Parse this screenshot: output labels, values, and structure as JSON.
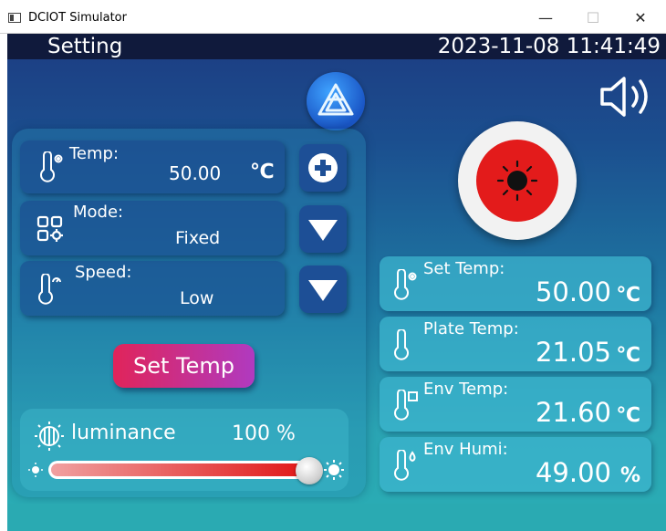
{
  "window": {
    "title": "DCIOT Simulator",
    "minimize": "—",
    "maximize": "☐",
    "close": "✕"
  },
  "header": {
    "page_title": "Setting",
    "datetime": "2023-11-08 11:41:49"
  },
  "settings": {
    "temp": {
      "label": "Temp:",
      "value": "50.00",
      "unit": "℃",
      "icon": "thermometer-gear-icon",
      "button_icon": "plus-icon"
    },
    "mode": {
      "label": "Mode:",
      "value": "Fixed",
      "icon": "mode-grid-icon",
      "button_icon": "dropdown-triangle-icon"
    },
    "speed": {
      "label": "Speed:",
      "value": "Low",
      "icon": "thermometer-gauge-icon",
      "button_icon": "dropdown-triangle-icon"
    }
  },
  "set_temp_button": "Set Temp",
  "luminance": {
    "label": "luminance",
    "value": "100 %",
    "level_fraction": 1.0
  },
  "readings": [
    {
      "label": "Set Temp:",
      "value": "50.00",
      "unit": "℃",
      "icon": "thermometer-gear-icon"
    },
    {
      "label": "Plate Temp:",
      "value": "21.05",
      "unit": "℃",
      "icon": "thermometer-icon"
    },
    {
      "label": "Env Temp:",
      "value": "21.60",
      "unit": "℃",
      "icon": "thermometer-box-icon"
    },
    {
      "label": "Env Humi:",
      "value": "49.00",
      "unit": "%",
      "icon": "thermometer-droplet-icon"
    }
  ],
  "colors": {
    "topbar": "#101a3c",
    "alarm_red": "#e31b1b",
    "button_blue": "#1d4f96",
    "set_temp_gradient_start": "#e0245a",
    "set_temp_gradient_end": "#b03ac0"
  }
}
